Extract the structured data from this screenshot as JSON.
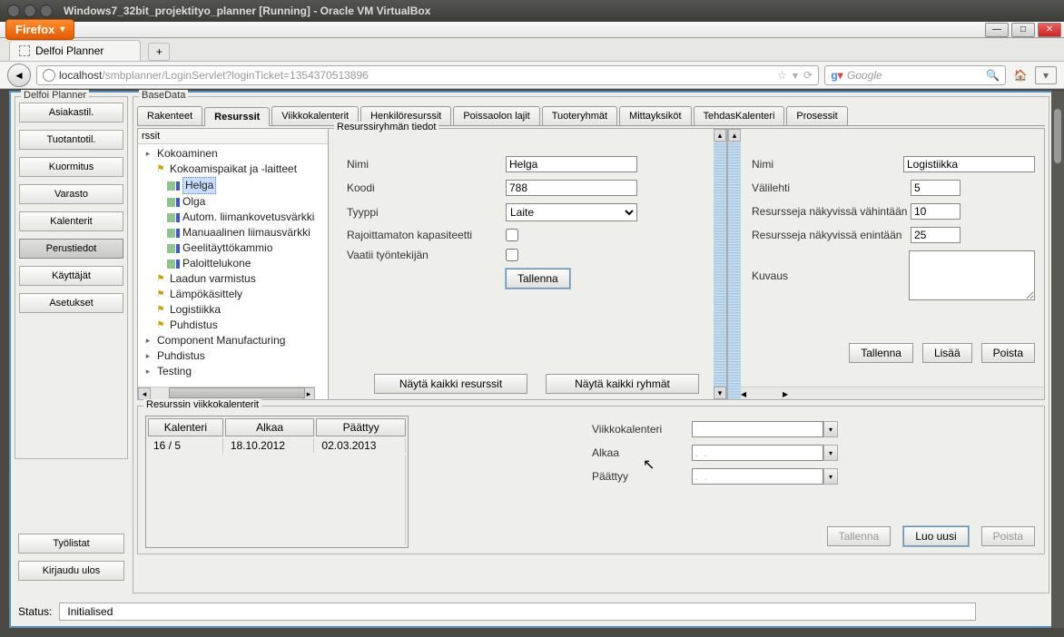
{
  "window": {
    "title": "Windows7_32bit_projektityo_planner [Running] - Oracle VM VirtualBox"
  },
  "firefox": {
    "label": "Firefox",
    "tab_title": "Delfoi Planner",
    "url_host": "localhost",
    "url_path": "/smbplanner/LoginServlet?loginTicket=1354370513896",
    "search_placeholder": "Google"
  },
  "sidebar": {
    "title": "Delfoi Planner",
    "buttons": [
      "Asiakastil.",
      "Tuotantotil.",
      "Kuormitus",
      "Varasto",
      "Kalenterit",
      "Perustiedot",
      "Käyttäjät",
      "Asetukset"
    ],
    "active": 5,
    "bottom": [
      "Työlistat",
      "Kirjaudu ulos"
    ]
  },
  "main": {
    "title": "BaseData",
    "tabs": [
      "Rakenteet",
      "Resurssit",
      "Viikkokalenterit",
      "Henkilöresurssit",
      "Poissaolon lajit",
      "Tuoteryhmät",
      "Mittayksiköt",
      "TehdasKalenteri",
      "Prosessit"
    ],
    "active_tab": 1
  },
  "tree": {
    "header": "rssit",
    "root0": "Kokoaminen",
    "group0": "Kokoamispaikat ja -laitteet",
    "items0": [
      "Helga",
      "Olga",
      "Autom. liimankovetusvärkki",
      "Manuaalinen liimausvärkki",
      "Geelitäyttökammio",
      "Paloittelukone"
    ],
    "nodes": [
      "Laadun varmistus",
      "Lämpökäsittely",
      "Logistiikka",
      "Puhdistus"
    ],
    "plain": [
      "Component Manufacturing",
      "Puhdistus",
      "Testing"
    ],
    "selected": "Helga"
  },
  "resource_form": {
    "title": "Resurssiryhmän tiedot",
    "labels": {
      "nimi": "Nimi",
      "koodi": "Koodi",
      "tyyppi": "Tyyppi",
      "unlimited": "Rajoittamaton kapasiteetti",
      "needs_worker": "Vaatii työntekijän"
    },
    "values": {
      "nimi": "Helga",
      "koodi": "788",
      "tyyppi": "Laite"
    },
    "save": "Tallenna",
    "show_all_res": "Näytä kaikki resurssit",
    "show_all_grp": "Näytä kaikki ryhmät"
  },
  "group_form": {
    "labels": {
      "nimi": "Nimi",
      "tab": "Välilehti",
      "min": "Resursseja näkyvissä vähintään",
      "max": "Resursseja näkyvissä enintään",
      "desc": "Kuvaus"
    },
    "values": {
      "nimi": "Logistiikka",
      "tab": "5",
      "min": "10",
      "max": "25"
    },
    "save": "Tallenna",
    "add": "Lisää",
    "delete": "Poista"
  },
  "calendar_section": {
    "title": "Resurssin viikkokalenterit",
    "headers": [
      "Kalenteri",
      "Alkaa",
      "Päättyy"
    ],
    "row": [
      "16 / 5",
      "18.10.2012",
      "02.03.2013"
    ],
    "form_labels": {
      "cal": "Viikkokalenteri",
      "start": "Alkaa",
      "end": "Päättyy"
    },
    "form_values": {
      "start": ".  .",
      "end": ".  ."
    },
    "save": "Tallenna",
    "new": "Luo uusi",
    "delete": "Poista"
  },
  "status": {
    "label": "Status:",
    "value": "Initialised"
  }
}
